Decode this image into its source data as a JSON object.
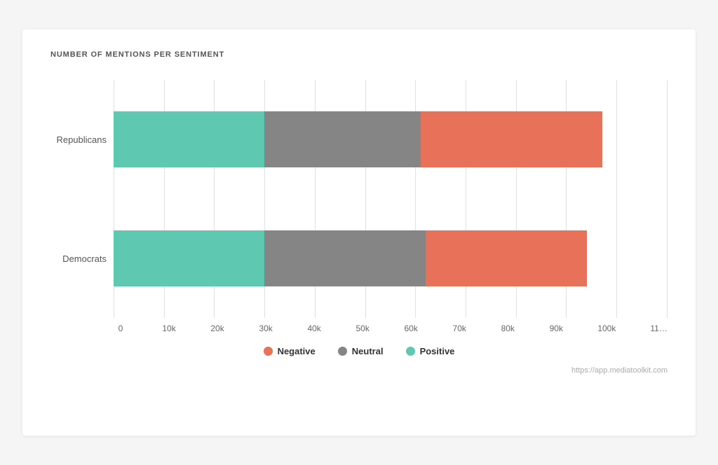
{
  "chart": {
    "title": "NUMBER OF MENTIONS PER SENTIMENT",
    "y_labels": [
      "Republicans",
      "Democrats"
    ],
    "x_labels": [
      "0",
      "10k",
      "20k",
      "30k",
      "40k",
      "50k",
      "60k",
      "70k",
      "80k",
      "90k",
      "100k",
      "11…"
    ],
    "max_value": 110000,
    "bars": [
      {
        "label": "Republicans",
        "positive": 30000,
        "neutral": 31000,
        "negative": 36000
      },
      {
        "label": "Democrats",
        "positive": 30000,
        "neutral": 32000,
        "negative": 32000
      }
    ],
    "legend": [
      {
        "key": "negative",
        "label": "Negative",
        "color": "#e8715a"
      },
      {
        "key": "neutral",
        "label": "Neutral",
        "color": "#858585"
      },
      {
        "key": "positive",
        "label": "Positive",
        "color": "#5ec8b0"
      }
    ],
    "watermark": "https://app.mediatoolkit.com"
  }
}
